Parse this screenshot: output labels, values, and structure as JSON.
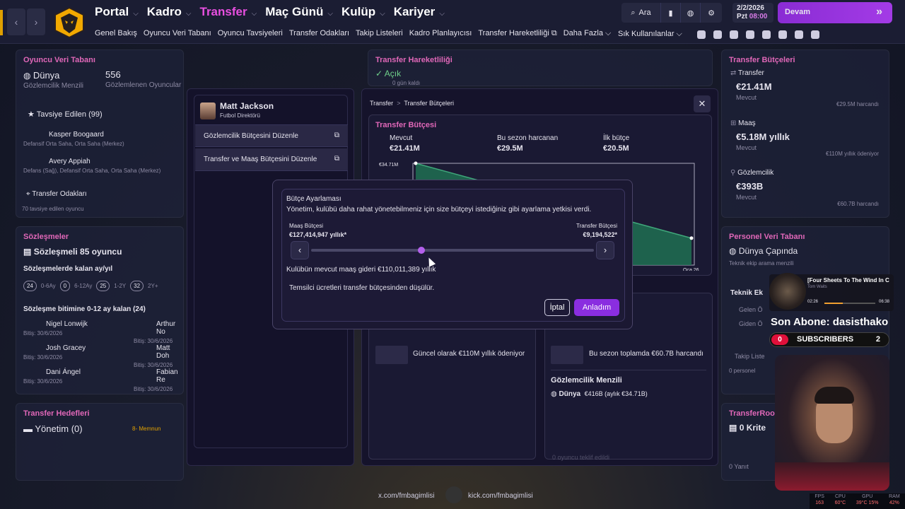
{
  "nav": {
    "main": [
      "Portal",
      "Kadro",
      "Transfer",
      "Maç Günü",
      "Kulüp",
      "Kariyer"
    ],
    "active": "Transfer",
    "sub": [
      "Genel Bakış",
      "Oyuncu Veri Tabanı",
      "Oyuncu Tavsiyeleri",
      "Transfer Odakları",
      "Takip Listeleri",
      "Kadro Planlayıcısı",
      "Transfer Hareketliliği",
      "Daha Fazla"
    ],
    "search_label": "Ara",
    "date_line1": "2/2/2026",
    "date_line2": "Pzt",
    "time": "08:00",
    "continue_label": "Devam",
    "shortcuts_label": "Sık Kullanılanlar"
  },
  "left": {
    "db_title": "Oyuncu Veri Tabanı",
    "db_world": "Dünya",
    "db_world_sub": "Gözlemcilik Menzili",
    "db_count": "556",
    "db_count_sub": "Gözlemlenen Oyuncular",
    "recommended": "Tavsiye Edilen (99)",
    "players": [
      {
        "name": "Kasper Boogaard",
        "pos": "Defansif Orta Saha, Orta Saha (Merkez)"
      },
      {
        "name": "Avery Appiah",
        "pos": "Defans (Sağ), Defansif Orta Saha, Orta Saha (Merkez)"
      }
    ],
    "focus": "Transfer Odakları",
    "focus_sub": "70 tavsiye edilen oyuncu",
    "contracts_title": "Sözleşmeler",
    "contracts_main": "Sözleşmeli 85 oyuncu",
    "contracts_remaining": "Sözleşmelerde kalan ay/yıl",
    "contract_badges": [
      {
        "n": "24",
        "t": "0-6Ay"
      },
      {
        "n": "0",
        "t": "6-12Ay"
      },
      {
        "n": "25",
        "t": "1-2Y"
      },
      {
        "n": "32",
        "t": "2Y+"
      }
    ],
    "expiring": "Sözleşme bitimine 0-12 ay kalan (24)",
    "expiring_players": [
      {
        "name": "Nigel Lonwijk",
        "date": "Bitiş: 30/6/2026"
      },
      {
        "name": "Arthur No",
        "date": "Bitiş: 30/6/2026"
      },
      {
        "name": "Josh Gracey",
        "date": "Bitiş: 30/6/2026"
      },
      {
        "name": "Matt Doh",
        "date": "Bitiş: 30/6/2026"
      },
      {
        "name": "Dani Ángel",
        "date": "Bitiş: 30/6/2026"
      },
      {
        "name": "Fabian Re",
        "date": "Bitiş: 30/6/2026"
      }
    ],
    "targets_title": "Transfer Hedefleri",
    "targets_main": "Yönetim (0)",
    "targets_badge": "8- Memnun"
  },
  "center_bg": {
    "title": "Transfer Hareketliliği",
    "status": "Açık",
    "status_sub": "0 gün kaldı"
  },
  "right": {
    "budget_title": "Transfer Bütçeleri",
    "transfer_label": "Transfer",
    "transfer_value": "€21.41M",
    "transfer_sub": "Mevcut",
    "transfer_spent": "€29.5M harcandı",
    "wage_label": "Maaş",
    "wage_value": "€5.18M yıllık",
    "wage_sub": "Mevcut",
    "wage_paid": "€110M yıllık ödeniyor",
    "scout_label": "Gözlemcilik",
    "scout_value": "€393B",
    "scout_sub": "Mevcut",
    "scout_spent": "€60.7B harcandı",
    "staff_title": "Personel Veri Tabanı",
    "staff_world": "Dünya Çapında",
    "staff_sub": "Teknik ekip arama menzili",
    "staff_tech": "Teknik Ek",
    "staff_in": "Gelen Ö",
    "staff_out": "Giden Ö",
    "watch": "Takip Liste",
    "watch_sub": "0 personel",
    "room_title": "TransferRoom (",
    "room_main": "0 Krite",
    "room_sub": "0 Yanıt"
  },
  "director": {
    "name": "Matt Jackson",
    "role": "Futbol Direktörü",
    "menu": [
      "Gözlemcilik Bütçesini Düzenle",
      "Transfer ve Maaş Bütçesini Düzenle"
    ]
  },
  "budget_panel": {
    "breadcrumb_root": "Transfer",
    "breadcrumb_current": "Transfer Bütçeleri",
    "section_title": "Transfer Bütçesi",
    "current_label": "Mevcut",
    "current_value": "€21.41M",
    "spent_label": "Bu sezon harcanan",
    "spent_value": "€29.5M",
    "initial_label": "İlk bütçe",
    "initial_value": "€20.5M",
    "chart_top_label": "€34.71M",
    "chart_end_label": "Oca 26",
    "wage_note": "Güncel olarak €110M yıllık ödeniyor",
    "scout_note": "Bu sezon toplamda €60.7B harcandı",
    "scout_range_title": "Gözlemcilik Menzili",
    "scout_range_world": "Dünya",
    "scout_range_value": "€416B (aylık €34.71B)",
    "staff_note": "0 oyuncu teklif edildi"
  },
  "chart_data": {
    "type": "area",
    "x": [
      "",
      "Oca 26"
    ],
    "y": [
      34.71,
      9.19
    ],
    "ylabel": "",
    "tick_labels": [
      "€34.71M",
      "Oca 26"
    ]
  },
  "modal": {
    "title": "Bütçe Ayarlaması",
    "desc": "Yönetim, kulübü daha rahat yönetebilmeniz için size bütçeyi istediğiniz gibi ayarlama yetkisi verdi.",
    "wage_label": "Maaş Bütçesi",
    "wage_value": "€127,414,947 yıllık*",
    "transfer_label": "Transfer Bütçesi",
    "transfer_value": "€9,194,522*",
    "slider_value": 0.39,
    "wage_expense": "Kulübün mevcut maaş gideri €110,011,389 yıllık",
    "agent_note": "Temsilci ücretleri transfer bütçesinden düşülür.",
    "cancel": "İptal",
    "confirm": "Anladım"
  },
  "stream": {
    "song_title": "[Four Sheets To The Wind In C",
    "song_artist": "Tom Waits",
    "time_now": "02:26",
    "time_end": "06:38",
    "last_sub": "Son Abone: dasisthako",
    "subs_label": "SUBSCRIBERS",
    "subs_left": "0",
    "subs_right": "2",
    "social_x": "x.com/fmbagimlisi",
    "social_kick": "kick.com/fmbagimlisi",
    "stats": [
      {
        "k": "FPS",
        "v": "163"
      },
      {
        "k": "CPU",
        "v": "60°C"
      },
      {
        "k": "GPU",
        "v": "39°C 15%"
      },
      {
        "k": "RAM",
        "v": "42%"
      }
    ]
  }
}
